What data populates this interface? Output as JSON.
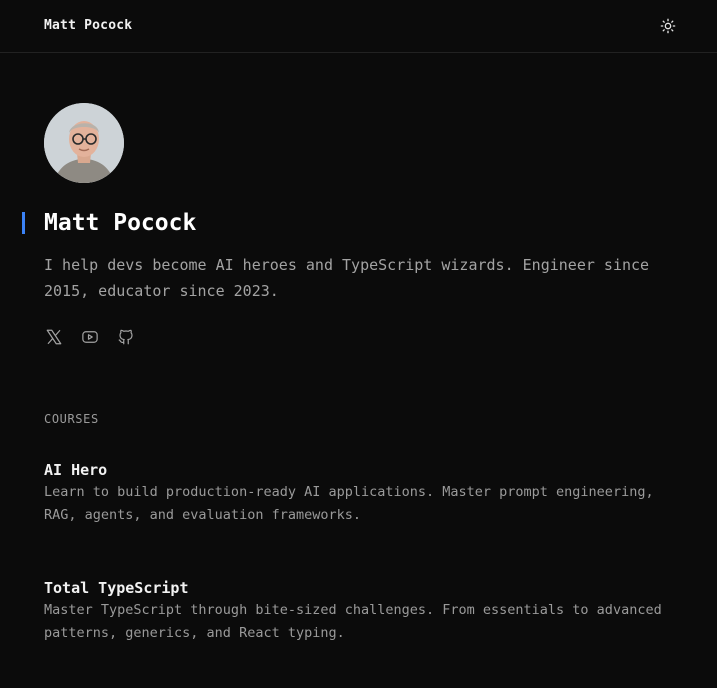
{
  "header": {
    "site_name": "Matt Pocock",
    "theme_toggle_icon": "sun-icon"
  },
  "profile": {
    "name": "Matt Pocock",
    "bio": "I help devs become AI heroes and TypeScript wizards. Engineer since 2015, educator since 2023.",
    "accent_color": "#3b82f6"
  },
  "socials": [
    {
      "icon": "x-icon"
    },
    {
      "icon": "youtube-icon"
    },
    {
      "icon": "github-icon"
    }
  ],
  "courses_section": {
    "label": "COURSES",
    "items": [
      {
        "title": "AI Hero",
        "description": "Learn to build production-ready AI applications. Master prompt engineering, RAG, agents, and evaluation frameworks."
      },
      {
        "title": "Total TypeScript",
        "description": "Master TypeScript through bite-sized challenges. From essentials to advanced patterns, generics, and React typing."
      }
    ]
  }
}
